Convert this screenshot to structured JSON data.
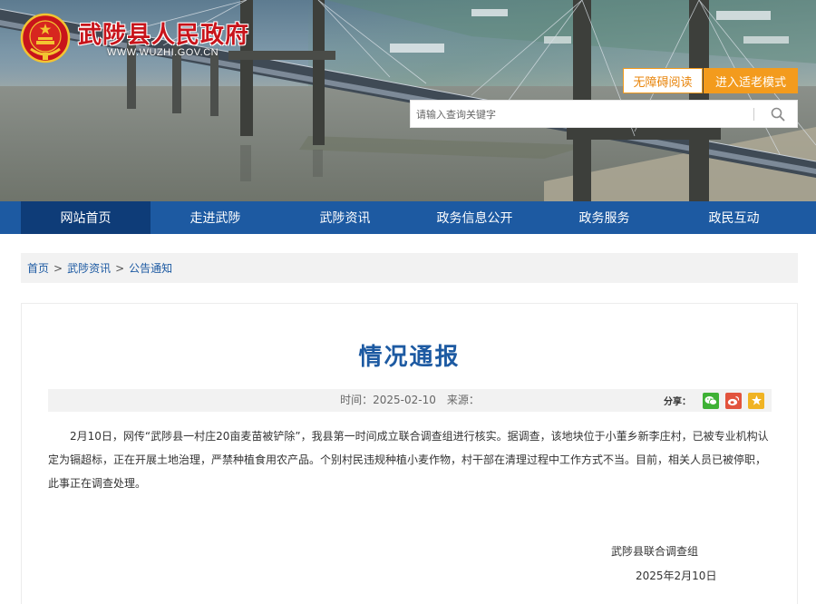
{
  "header": {
    "site_name": "武陟县人民政府",
    "site_domain": "WWW.WUZHI.GOV.CN",
    "accessible_label": "无障碍阅读",
    "elder_mode_label": "进入适老模式",
    "search_placeholder": "请输入查询关键字"
  },
  "nav": {
    "items": [
      "网站首页",
      "走进武陟",
      "武陟资讯",
      "政务信息公开",
      "政务服务",
      "政民互动"
    ],
    "active_index": 0
  },
  "breadcrumb": {
    "items": [
      "首页",
      "武陟资讯",
      "公告通知"
    ],
    "separator": ">"
  },
  "article": {
    "title": "情况通报",
    "time_label": "时间：",
    "time_value": "2025-02-10",
    "source_label": "来源：",
    "share_label": "分享：",
    "body": "2月10日，网传“武陟县一村庄20亩麦苗被铲除”，我县第一时间成立联合调查组进行核实。据调查，该地块位于小董乡新李庄村，已被专业机构认定为镉超标，正在开展土地治理，严禁种植食用农产品。个别村民违规种植小麦作物，村干部在清理过程中工作方式不当。目前，相关人员已被停职，此事正在调查处理。",
    "signature": "武陟县联合调查组",
    "date": "2025年2月10日"
  },
  "colors": {
    "brand_red": "#c8141b",
    "nav_blue": "#1d5aa2",
    "nav_active": "#0e3c78",
    "accent_orange": "#f39b1d",
    "title_blue": "#1d5aa2"
  },
  "icons": {
    "logo": "national-emblem-icon",
    "search": "search-icon",
    "share": [
      "wechat-icon",
      "weibo-icon",
      "favorite-icon"
    ]
  }
}
